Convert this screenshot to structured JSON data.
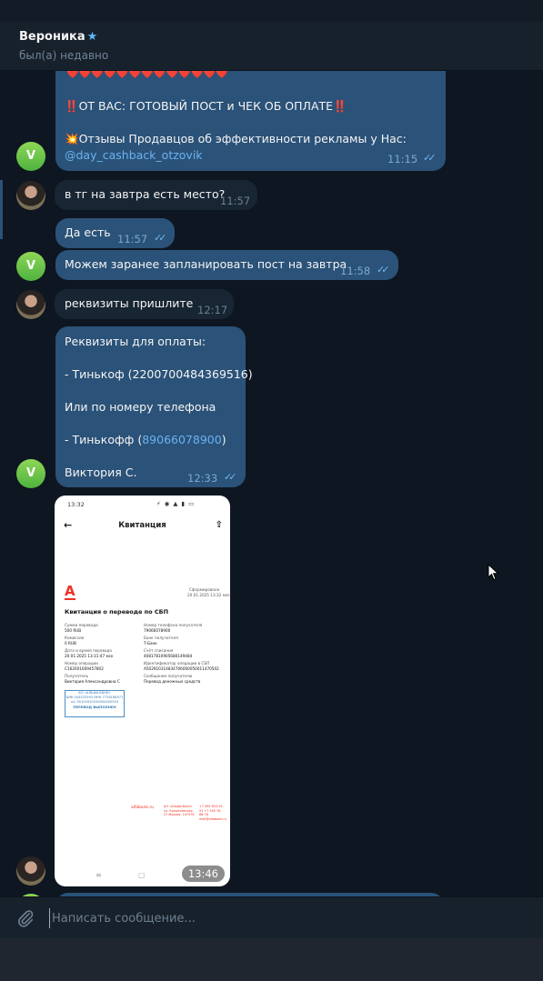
{
  "header": {
    "name": "Вероника",
    "status": "был(а) недавно"
  },
  "messages": {
    "m1": {
      "hearts": "❤️❤️❤️❤️❤️❤️❤️❤️❤️❤️❤️❤️❤️",
      "line1_icon": "‼️",
      "line1": "ОТ ВАС: ГОТОВЫЙ ПОСТ и ЧЕК ОБ ОПЛАТЕ",
      "line1_icon2": "‼️",
      "line2_icon": "💥",
      "line2": "Отзывы Продавцов об эффективности рекламы у Нас:",
      "link": "@day_cashback_otzovik",
      "time": "11:15"
    },
    "m2": {
      "text": "в тг на завтра есть место?",
      "time": "11:57"
    },
    "m3": {
      "text": "Да есть",
      "time": "11:57"
    },
    "m4": {
      "text": "Можем заранее запланировать пост на завтра",
      "time": "11:58"
    },
    "m5": {
      "text": "реквизиты пришлите",
      "time": "12:17"
    },
    "m6": {
      "l1": "Реквизиты для оплаты:",
      "l2": "-  Тинькоф (2200700484369516)",
      "l3": "Или  по номеру телефона",
      "l4a": "- Тинькофф (",
      "l4link": "89066078900",
      "l4b": ")",
      "l5": "Виктория С.",
      "time": "12:33"
    },
    "m7": {
      "time": "13:46"
    }
  },
  "avatar_letter": "V",
  "receipt": {
    "status_time": "13:32",
    "title": "Квитанция",
    "logo": "А",
    "status_right": "Сформирована",
    "date_right": "20.01.2025 13:32 мск",
    "heading": "Квитанция о переводе по СБП",
    "rows": [
      [
        "Сумма перевода",
        "500 RUB",
        "Номер телефона получателя",
        "79066078900"
      ],
      [
        "Комиссия",
        "0 RUB",
        "Банк получателя",
        "Т-Банк"
      ],
      [
        "Дата и время перевода",
        "20.01.2025 13:31:47 мск",
        "Счёт списания",
        "40817810905680149484"
      ],
      [
        "Номер операции",
        "C162001009457802",
        "Идентификатор операции в СБП",
        "A502910314834706000050011470502"
      ],
      [
        "Получатель",
        "Виктория Александровна С",
        "Сообщение получателю",
        "Перевод денежных средств"
      ]
    ],
    "stamp_line1": "АО «АЛЬФА-БАНК»",
    "stamp_line2": "БИК 044525593 ИНН 7728168971",
    "stamp_line3": "к/с 30101810200000000593",
    "stamp_line4": "ПЕРЕВОД ВЫПОЛНЕН",
    "footer1": "alfabank.ru",
    "footer2": "АО «Альфа-Банк» ул. Каланчёвская, 27 Москва, 107078",
    "footer3": "+7 495 620-91-91 +7 495 78-88-78 mail@alfabank.ru"
  },
  "composer": {
    "placeholder": "Написать сообщение..."
  }
}
